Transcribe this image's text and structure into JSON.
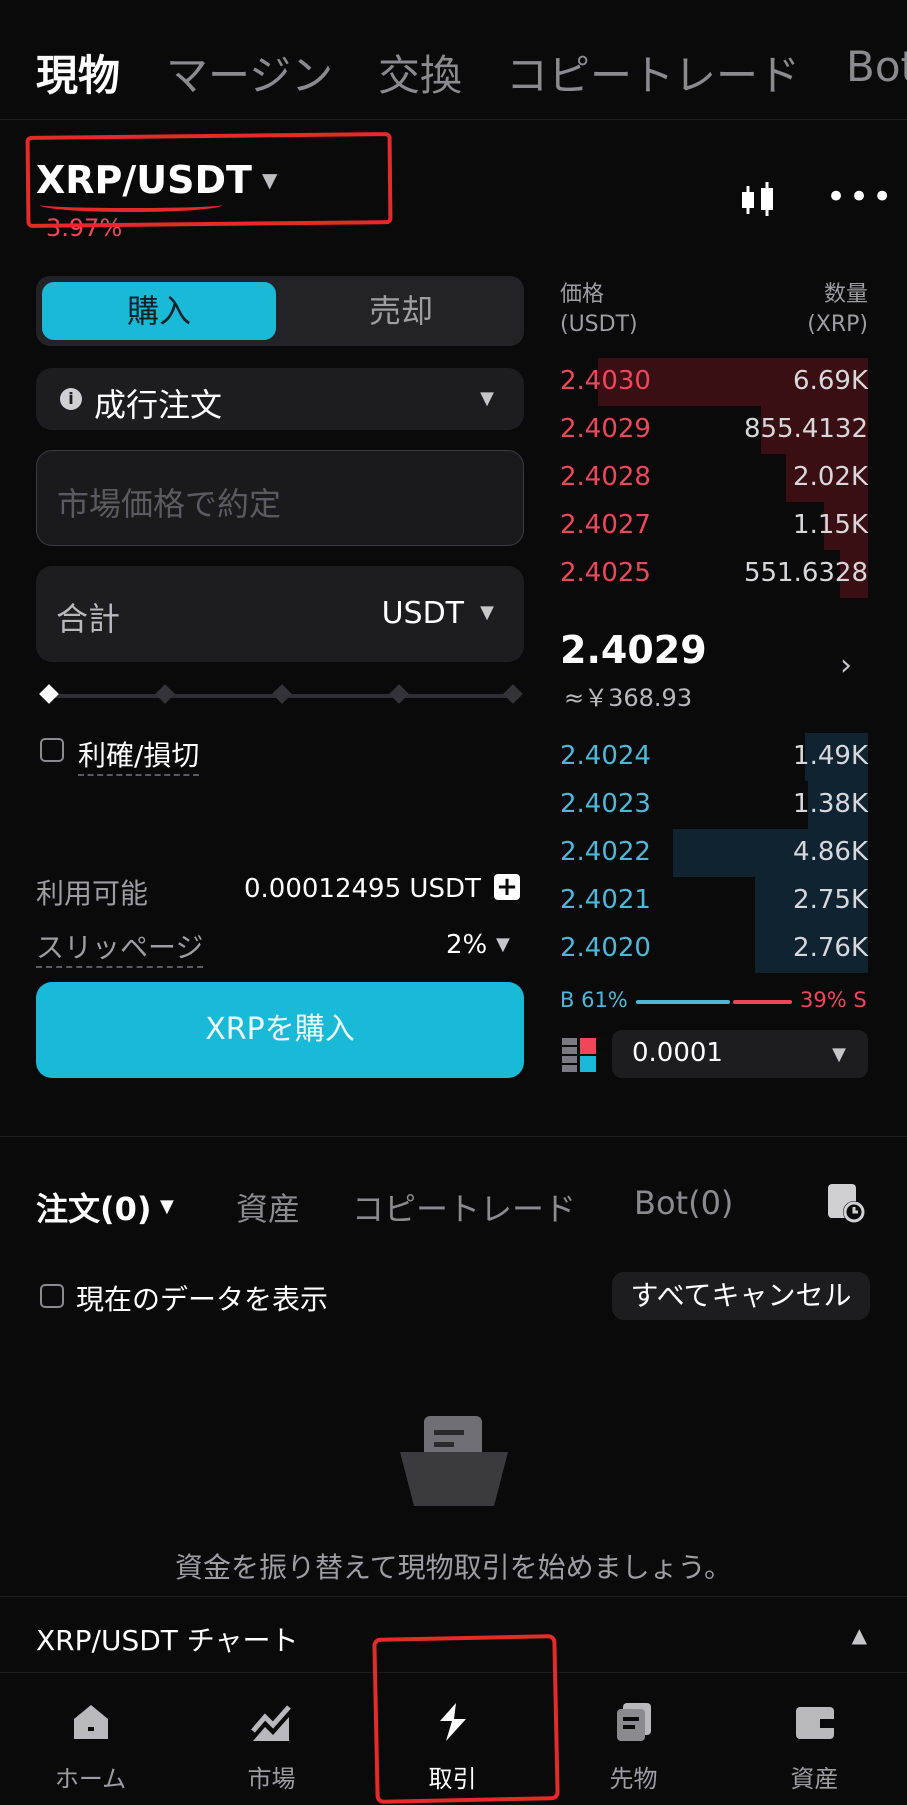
{
  "top_tabs": [
    {
      "label": "現物",
      "active": true
    },
    {
      "label": "マージン",
      "active": false
    },
    {
      "label": "交換",
      "active": false
    },
    {
      "label": "コピートレード",
      "active": false
    },
    {
      "label": "Bot",
      "active": false
    }
  ],
  "pair": {
    "name": "XRP/USDT",
    "change": "3.97%"
  },
  "side_toggle": {
    "buy": "購入",
    "sell": "売却"
  },
  "order_type": {
    "label": "成行注文",
    "info_icon": "i"
  },
  "price_input": {
    "placeholder": "市場価格で約定"
  },
  "total": {
    "label": "合計",
    "unit": "USDT"
  },
  "tpsl": {
    "label": "利確/損切"
  },
  "available": {
    "label": "利用可能",
    "value": "0.00012495 USDT"
  },
  "slippage": {
    "label": "スリッページ",
    "value": "2%"
  },
  "buy_button": {
    "label": "XRPを購入"
  },
  "order_book": {
    "price_header": [
      "価格",
      "(USDT)"
    ],
    "qty_header": [
      "数量",
      "(XRP)"
    ],
    "asks": [
      {
        "price": "2.4030",
        "qty": "6.69K",
        "depth": 0.86
      },
      {
        "price": "2.4029",
        "qty": "855.4132",
        "depth": 0.34
      },
      {
        "price": "2.4028",
        "qty": "2.02K",
        "depth": 0.26
      },
      {
        "price": "2.4027",
        "qty": "1.15K",
        "depth": 0.14
      },
      {
        "price": "2.4025",
        "qty": "551.6328",
        "depth": 0.09
      }
    ],
    "last_price": "2.4029",
    "last_price_fiat": "≈￥368.93",
    "bids": [
      {
        "price": "2.4024",
        "qty": "1.49K",
        "depth": 0.2
      },
      {
        "price": "2.4023",
        "qty": "1.38K",
        "depth": 0.19
      },
      {
        "price": "2.4022",
        "qty": "4.86K",
        "depth": 0.62
      },
      {
        "price": "2.4021",
        "qty": "2.75K",
        "depth": 0.36
      },
      {
        "price": "2.4020",
        "qty": "2.76K",
        "depth": 0.36
      }
    ],
    "buy_ratio": "B 61%",
    "sell_ratio": "39% S",
    "buy_ratio_value": 0.61,
    "depth_step": "0.0001"
  },
  "order_tabs": [
    {
      "label": "注文(0)",
      "active": true
    },
    {
      "label": "資産",
      "active": false
    },
    {
      "label": "コピートレード",
      "active": false
    },
    {
      "label": "Bot(0)",
      "active": false
    }
  ],
  "show_current": {
    "label": "現在のデータを表示"
  },
  "cancel_all": {
    "label": "すべてキャンセル"
  },
  "empty_message": "資金を振り替えて現物取引を始めましょう。",
  "chart_bar": {
    "label": "XRP/USDT チャート"
  },
  "bottom_nav": [
    {
      "label": "ホーム",
      "icon": "home-icon",
      "active": false
    },
    {
      "label": "市場",
      "icon": "market-icon",
      "active": false
    },
    {
      "label": "取引",
      "icon": "trade-icon",
      "active": true
    },
    {
      "label": "先物",
      "icon": "futures-icon",
      "active": false
    },
    {
      "label": "資産",
      "icon": "wallet-icon",
      "active": false
    }
  ],
  "colors": {
    "accent": "#19b9d8",
    "ask": "#f0465a",
    "bid": "#4fb8d8",
    "annotation": "#e52a2a"
  }
}
